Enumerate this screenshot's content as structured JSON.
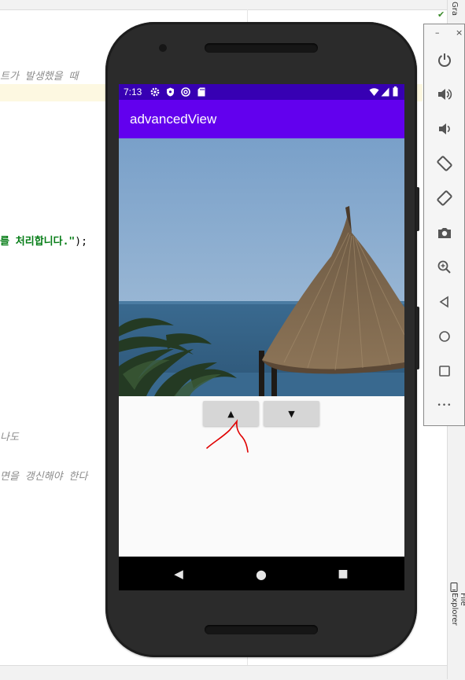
{
  "ide": {
    "code_lines": [
      {
        "text": "트가 발생했을 때",
        "style": "comment"
      },
      {
        "text": "를 처리합니다.\"",
        "suffix": ");",
        "style": "string"
      },
      {
        "text": "나도",
        "style": "comment"
      },
      {
        "text": "면을 갱신해야 한다",
        "style": "comment"
      }
    ],
    "right_strip": {
      "top_label": "Gra",
      "bottom_label": "Device File Explorer"
    }
  },
  "emulator_toolbar": {
    "minimize_label": "–",
    "close_label": "×",
    "buttons": [
      "power-icon",
      "volume-up-icon",
      "volume-down-icon",
      "rotate-left-icon",
      "rotate-right-icon",
      "camera-icon",
      "zoom-icon",
      "back-icon",
      "home-icon",
      "overview-icon",
      "more-icon"
    ],
    "more_label": "•••"
  },
  "device": {
    "status_bar": {
      "time": "7:13",
      "left_icons": [
        "settings-icon",
        "shield-icon",
        "sync-icon",
        "sd-card-icon"
      ],
      "right_icons": [
        "wifi-icon",
        "signal-icon",
        "battery-icon"
      ]
    },
    "app_bar": {
      "title": "advancedView",
      "color": "#6200ee",
      "status_color": "#3700b3"
    },
    "image": {
      "subject": "thatched beach umbrella with palm leaves and sea"
    },
    "buttons": {
      "up_label": "▲",
      "down_label": "▼"
    },
    "nav_bar": {
      "back_label": "◀",
      "home_label": "●",
      "overview_label": "■"
    }
  },
  "annotation": {
    "color": "#e00000"
  }
}
